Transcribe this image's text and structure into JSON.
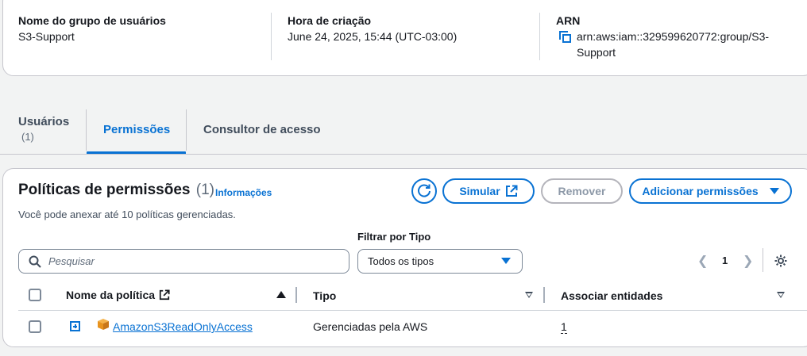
{
  "summary": {
    "group_name_label": "Nome do grupo de usuários",
    "group_name_value": "S3-Support",
    "created_label": "Hora de criação",
    "created_value": "June 24, 2025, 15:44 (UTC-03:00)",
    "arn_label": "ARN",
    "arn_line1": "arn:aws:iam::329599620772:group/S3-",
    "arn_line2": "Support",
    "copy_icon": "copy-icon"
  },
  "tabs": [
    {
      "label": "Usuários",
      "sub": "(1)"
    },
    {
      "label": "Permissões"
    },
    {
      "label": "Consultor de acesso"
    }
  ],
  "policies": {
    "title": "Políticas de permissões",
    "count": "(1)",
    "info": "Informações",
    "description": "Você pode anexar até 10 políticas gerenciadas.",
    "refresh_icon": "refresh-icon",
    "simulate": "Simular",
    "remove": "Remover",
    "add": "Adicionar permissões",
    "filter_label": "Filtrar por Tipo",
    "search_placeholder": "Pesquisar",
    "type_select": "Todos os tipos",
    "page": "1",
    "columns": {
      "name": "Nome da política",
      "type": "Tipo",
      "entities": "Associar entidades"
    },
    "rows": [
      {
        "name": "AmazonS3ReadOnlyAccess",
        "type": "Gerenciadas pela AWS",
        "entities": "1"
      }
    ]
  },
  "colors": {
    "accent": "#0972d3",
    "aws_orange": "#e8931e"
  }
}
